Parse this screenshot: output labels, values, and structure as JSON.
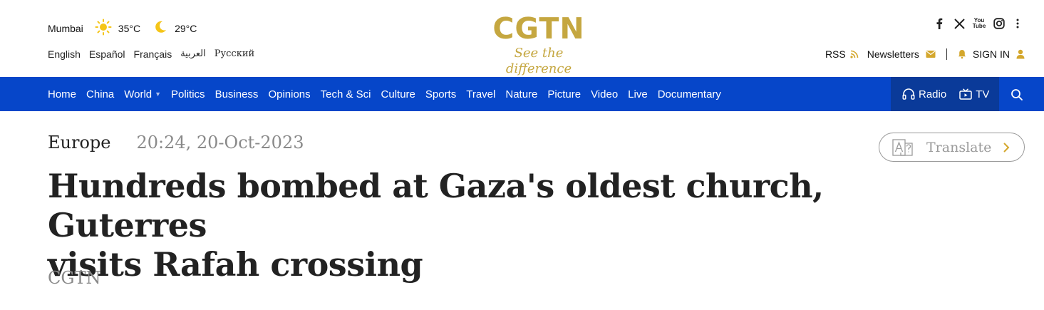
{
  "weather": {
    "city": "Mumbai",
    "day_temp": "35°C",
    "night_temp": "29°C",
    "day_icon": "sun-icon",
    "night_icon": "moon-icon"
  },
  "languages": [
    "English",
    "Español",
    "Français",
    "العربية",
    "Русский"
  ],
  "logo": {
    "wordmark": "CGTN",
    "tagline": "See the difference",
    "color": "#c5a740"
  },
  "social": {
    "icons": [
      "facebook-icon",
      "x-icon",
      "youtube-icon",
      "instagram-icon",
      "more-icon"
    ],
    "youtube_text": "You Tube"
  },
  "userbar": {
    "rss_label": "RSS",
    "newsletters_label": "Newsletters",
    "signin_label": "SIGN IN",
    "accent": "#d4a72c"
  },
  "nav": {
    "background": "#0646c9",
    "items": [
      "Home",
      "China",
      "World",
      "Politics",
      "Business",
      "Opinions",
      "Tech & Sci",
      "Culture",
      "Sports",
      "Travel",
      "Nature",
      "Picture",
      "Video",
      "Live",
      "Documentary"
    ],
    "world_has_dropdown": true,
    "radio_label": "Radio",
    "tv_label": "TV"
  },
  "article": {
    "section": "Europe",
    "datetime": "20:24, 20-Oct-2023",
    "translate_label": "Translate",
    "headline_line1": "Hundreds bombed at Gaza's oldest church, Guterres",
    "headline_line2": "visits Rafah crossing",
    "byline": "CGTN"
  }
}
